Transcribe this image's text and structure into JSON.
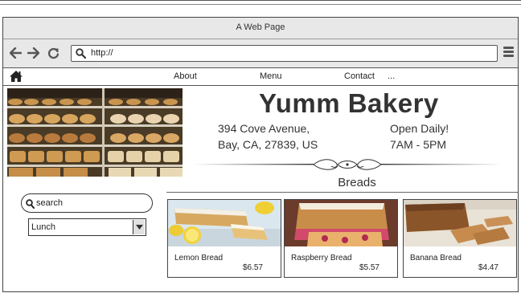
{
  "window": {
    "title": "A Web Page"
  },
  "browser": {
    "url": "http://",
    "icons": [
      "back-arrow-icon",
      "forward-arrow-icon",
      "reload-icon",
      "search-icon",
      "hamburger-menu-icon"
    ]
  },
  "site_nav": {
    "home_icon": "home-icon",
    "links": [
      "About",
      "Menu",
      "Contact",
      "..."
    ]
  },
  "header": {
    "brand": "Yumm Bakery",
    "address_line1": "394 Cove Avenue,",
    "address_line2": "Bay, CA, 27839, US",
    "hours_line1": "Open Daily!",
    "hours_line2": "7AM - 5PM"
  },
  "section": {
    "title": "Breads"
  },
  "search": {
    "placeholder": "search"
  },
  "filter": {
    "selected": "Lunch"
  },
  "products": [
    {
      "name": "Lemon Bread",
      "price": "$6.57"
    },
    {
      "name": "Raspberry Bread",
      "price": "$5.57"
    },
    {
      "name": "Banana Bread",
      "price": "$4.47"
    }
  ]
}
